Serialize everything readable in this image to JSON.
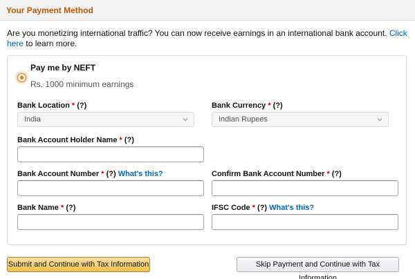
{
  "header": {
    "title": "Your Payment Method"
  },
  "intro": {
    "text": "Are you monetizing international traffic? You can now receive earnings in an international bank account.",
    "link": "Click here",
    "suffix": "to learn more."
  },
  "option": {
    "title": "Pay me by NEFT",
    "subtitle": "Rs. 1000 minimum earnings",
    "selected": true
  },
  "fields": {
    "bank_location": {
      "label": "Bank Location",
      "req": "*",
      "help": "(?)",
      "value": "India"
    },
    "bank_currency": {
      "label": "Bank Currency",
      "req": "*",
      "help": "(?)",
      "value": "Indian Rupees"
    },
    "holder_name": {
      "label": "Bank Account Holder Name",
      "req": "*",
      "help": "(?)",
      "value": ""
    },
    "account_number": {
      "label": "Bank Account Number",
      "req": "*",
      "help": "(?)",
      "whats": "What's this?",
      "value": ""
    },
    "confirm_account": {
      "label": "Confirm Bank Account Number",
      "req": "*",
      "help": "(?)",
      "value": ""
    },
    "bank_name": {
      "label": "Bank Name",
      "req": "*",
      "help": "(?)",
      "value": ""
    },
    "ifsc": {
      "label": "IFSC Code",
      "req": "*",
      "help": "(?)",
      "whats": "What's this?",
      "value": ""
    }
  },
  "buttons": {
    "submit": "Submit and Continue with Tax Information",
    "skip": "Skip Payment and Continue with Tax Information"
  },
  "colors": {
    "header_title": "#c45500",
    "link": "#0066c0",
    "required": "#c40000",
    "radio": "#e77600",
    "primary_button": "#f0c14b"
  }
}
